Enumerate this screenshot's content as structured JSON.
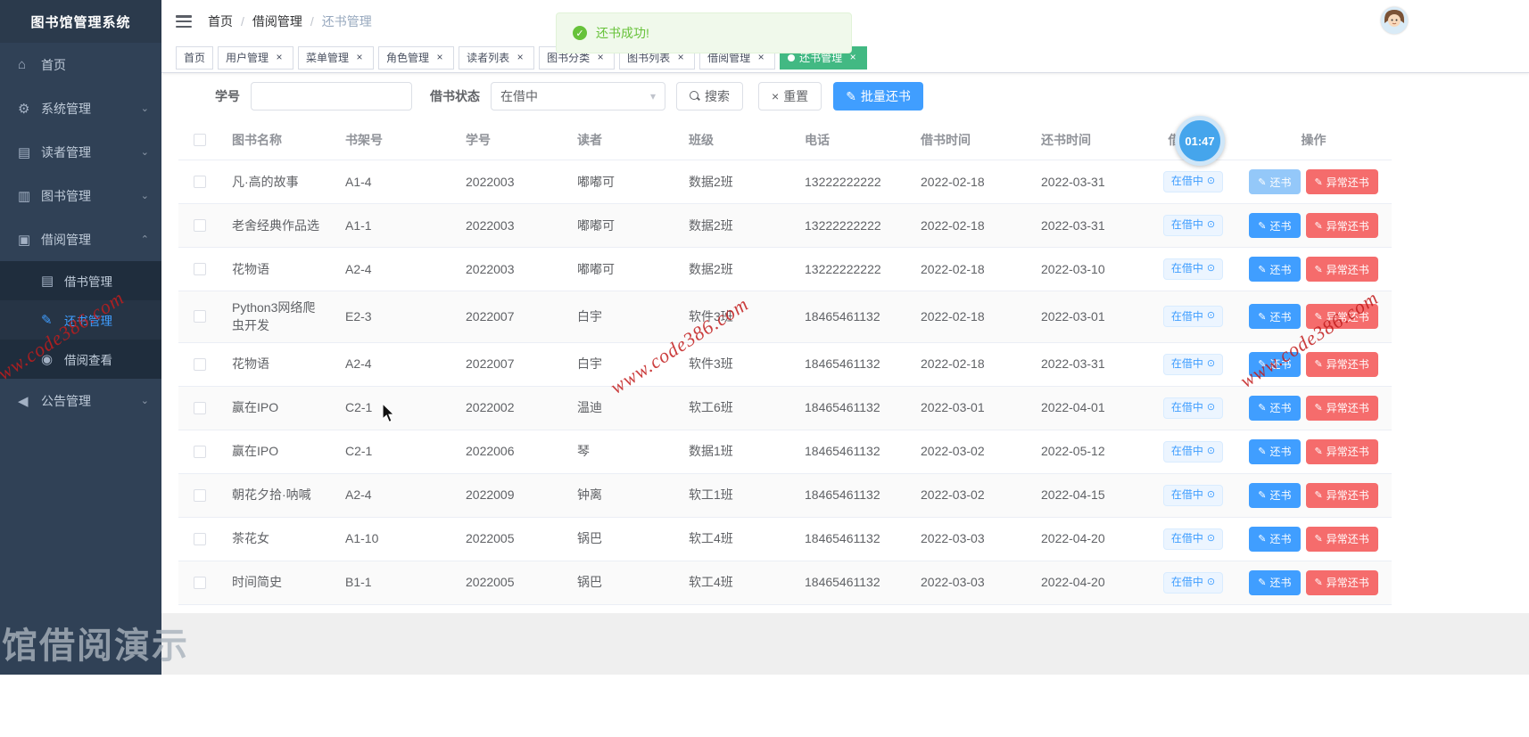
{
  "app": {
    "title": "图书馆管理系统"
  },
  "sidebar": {
    "items": [
      {
        "label": "首页",
        "icon": "home-icon"
      },
      {
        "label": "系统管理",
        "icon": "gear-icon"
      },
      {
        "label": "读者管理",
        "icon": "reader-icon"
      },
      {
        "label": "图书管理",
        "icon": "books-icon"
      },
      {
        "label": "借阅管理",
        "icon": "borrow-icon",
        "children": [
          "借书管理",
          "还书管理",
          "借阅查看"
        ]
      },
      {
        "label": "公告管理",
        "icon": "megaphone-icon"
      }
    ]
  },
  "navbar": {
    "breadcrumb": [
      "首页",
      "借阅管理",
      "还书管理"
    ]
  },
  "toast": {
    "message": "还书成功!"
  },
  "tabs": [
    {
      "label": "首页",
      "closable": false,
      "active": false
    },
    {
      "label": "用户管理",
      "closable": true,
      "active": false
    },
    {
      "label": "菜单管理",
      "closable": true,
      "active": false
    },
    {
      "label": "角色管理",
      "closable": true,
      "active": false
    },
    {
      "label": "读者列表",
      "closable": true,
      "active": false
    },
    {
      "label": "图书分类",
      "closable": true,
      "active": false
    },
    {
      "label": "图书列表",
      "closable": true,
      "active": false
    },
    {
      "label": "借阅管理",
      "closable": true,
      "active": false
    },
    {
      "label": "还书管理",
      "closable": true,
      "active": true
    }
  ],
  "filter": {
    "student_label": "学号",
    "student_value": "",
    "status_label": "借书状态",
    "status_value": "在借中",
    "search_label": "搜索",
    "reset_label": "重置",
    "batch_return_label": "批量还书"
  },
  "table": {
    "columns": [
      "图书名称",
      "书架号",
      "学号",
      "读者",
      "班级",
      "电话",
      "借书时间",
      "还书时间",
      "借书状态",
      "操作"
    ],
    "actions": {
      "return_label": "还书",
      "abnormal_label": "异常还书"
    },
    "icons": {
      "return_icon": "pencil-icon",
      "abnormal_icon": "pencil-icon",
      "status_icon": "loading-circle-icon"
    },
    "rows": [
      {
        "book": "凡·高的故事",
        "shelf": "A1-4",
        "sid": "2022003",
        "reader": "嘟嘟可",
        "cls": "数据2班",
        "phone": "13222222222",
        "borrowed": "2022-02-18",
        "due": "2022-03-31",
        "status": "在借中",
        "return_light": true
      },
      {
        "book": "老舍经典作品选",
        "shelf": "A1-1",
        "sid": "2022003",
        "reader": "嘟嘟可",
        "cls": "数据2班",
        "phone": "13222222222",
        "borrowed": "2022-02-18",
        "due": "2022-03-31",
        "status": "在借中"
      },
      {
        "book": "花物语",
        "shelf": "A2-4",
        "sid": "2022003",
        "reader": "嘟嘟可",
        "cls": "数据2班",
        "phone": "13222222222",
        "borrowed": "2022-02-18",
        "due": "2022-03-10",
        "status": "在借中"
      },
      {
        "book": "Python3网络爬虫开发",
        "shelf": "E2-3",
        "sid": "2022007",
        "reader": "白宇",
        "cls": "软件3班",
        "phone": "18465461132",
        "borrowed": "2022-02-18",
        "due": "2022-03-01",
        "status": "在借中"
      },
      {
        "book": "花物语",
        "shelf": "A2-4",
        "sid": "2022007",
        "reader": "白宇",
        "cls": "软件3班",
        "phone": "18465461132",
        "borrowed": "2022-02-18",
        "due": "2022-03-31",
        "status": "在借中"
      },
      {
        "book": "赢在IPO",
        "shelf": "C2-1",
        "sid": "2022002",
        "reader": "温迪",
        "cls": "软工6班",
        "phone": "18465461132",
        "borrowed": "2022-03-01",
        "due": "2022-04-01",
        "status": "在借中",
        "hover": true
      },
      {
        "book": "赢在IPO",
        "shelf": "C2-1",
        "sid": "2022006",
        "reader": "琴",
        "cls": "数据1班",
        "phone": "18465461132",
        "borrowed": "2022-03-02",
        "due": "2022-05-12",
        "status": "在借中"
      },
      {
        "book": "朝花夕拾·呐喊",
        "shelf": "A2-4",
        "sid": "2022009",
        "reader": "钟离",
        "cls": "软工1班",
        "phone": "18465461132",
        "borrowed": "2022-03-02",
        "due": "2022-04-15",
        "status": "在借中"
      },
      {
        "book": "茶花女",
        "shelf": "A1-10",
        "sid": "2022005",
        "reader": "锅巴",
        "cls": "软工4班",
        "phone": "18465461132",
        "borrowed": "2022-03-03",
        "due": "2022-04-20",
        "status": "在借中"
      },
      {
        "book": "时间简史",
        "shelf": "B1-1",
        "sid": "2022005",
        "reader": "锅巴",
        "cls": "软工4班",
        "phone": "18465461132",
        "borrowed": "2022-03-03",
        "due": "2022-04-20",
        "status": "在借中"
      }
    ]
  },
  "overlays": {
    "timer": "01:47",
    "site_watermark": "www.code386.com",
    "page_watermark": "馆借阅演示"
  }
}
